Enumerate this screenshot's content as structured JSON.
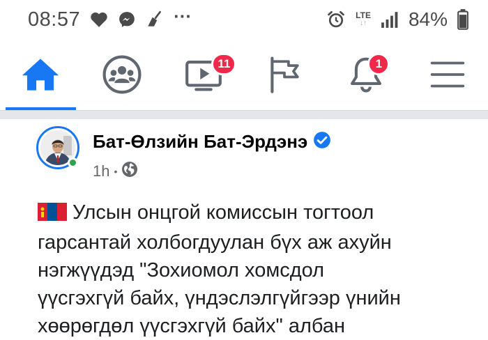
{
  "status_bar": {
    "time": "08:57",
    "more": "···",
    "network_label": "LTE",
    "battery_percent": "84%",
    "icons": [
      "heart-icon",
      "messenger-icon",
      "broom-icon",
      "more-icon",
      "alarm-icon",
      "lte-icon",
      "signal-icon",
      "battery-icon"
    ]
  },
  "tabs": [
    {
      "name": "home",
      "icon": "home-icon",
      "active": true
    },
    {
      "name": "groups",
      "icon": "groups-icon",
      "active": false
    },
    {
      "name": "watch",
      "icon": "video-icon",
      "badge": "11",
      "active": false
    },
    {
      "name": "pages",
      "icon": "flag-icon",
      "active": false
    },
    {
      "name": "notifications",
      "icon": "bell-icon",
      "badge": "1",
      "active": false
    },
    {
      "name": "menu",
      "icon": "menu-icon",
      "active": false
    }
  ],
  "post": {
    "author": "Бат-Өлзийн Бат-Эрдэнэ",
    "verified": true,
    "online": true,
    "time": "1h",
    "separator": "•",
    "audience": "globe-icon",
    "flag": "mongolia-flag-icon",
    "lines": [
      "Улсын онцгой комиссын тогтоол",
      "гарсантай холбогдуулан бүх аж ахуйн",
      "нэгжүүдэд \"Зохиомол хомсдол",
      "үүсгэхгүй байх, үндэслэлгүйгээр үнийн",
      "хөөрөгдөл үүсгэхгүй байх\" албан"
    ]
  },
  "colors": {
    "accent": "#1877f2",
    "badge": "#f02849",
    "online": "#31a24c",
    "icon": "#606770"
  }
}
